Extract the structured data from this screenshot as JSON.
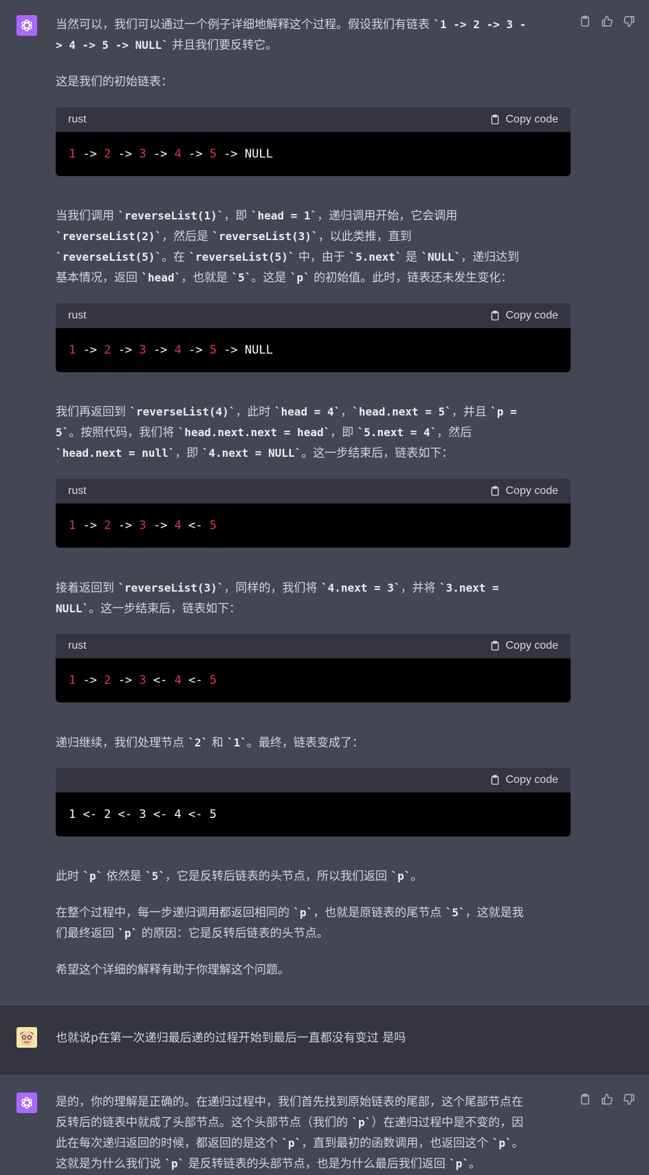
{
  "messages": [
    {
      "role": "assistant",
      "p1_a": "当然可以，我们可以通过一个例子详细地解释这个过程。假设我们有链表 ",
      "p1_code": "`1 -> 2 -> 3 -",
      "p1_code2": "> 4 -> 5 -> NULL`",
      "p1_b": " 并且我们要反转它。",
      "p2": "这是我们的初始链表：",
      "code1": {
        "lang": "rust",
        "copy_label": "Copy code",
        "tokens": [
          "1",
          " -> ",
          "2",
          " -> ",
          "3",
          " -> ",
          "4",
          " -> ",
          "5",
          " -> NULL"
        ]
      },
      "p3": {
        "l1_a": "当我们调用 ",
        "l1_c1": "`reverseList(1)`",
        "l1_b": "，即 ",
        "l1_c2": "`head = 1`",
        "l1_d": "，递归调用开始，它会调用",
        "l2_c1": "`reverseList(2)`",
        "l2_a": "，然后是 ",
        "l2_c2": "`reverseList(3)`",
        "l2_b": "，以此类推，直到",
        "l3_c1": "`reverseList(5)`",
        "l3_a": "。在 ",
        "l3_c2": "`reverseList(5)`",
        "l3_b": " 中，由于 ",
        "l3_c3": "`5.next`",
        "l3_d": " 是 ",
        "l3_c4": "`NULL`",
        "l3_e": "，递归达到",
        "l4_a": "基本情况，返回 ",
        "l4_c1": "`head`",
        "l4_b": "，也就是 ",
        "l4_c2": "`5`",
        "l4_d": "。这是 ",
        "l4_c3": "`p`",
        "l4_e": " 的初始值。此时，链表还未发生变化："
      },
      "code2": {
        "lang": "rust",
        "copy_label": "Copy code",
        "tokens": [
          "1",
          " -> ",
          "2",
          " -> ",
          "3",
          " -> ",
          "4",
          " -> ",
          "5",
          " -> NULL"
        ]
      },
      "p4": {
        "l1_a": "我们再返回到 ",
        "l1_c1": "`reverseList(4)`",
        "l1_b": "，此时 ",
        "l1_c2": "`head = 4`",
        "l1_d": "，",
        "l1_c3": "`head.next = 5`",
        "l1_e": "，并且 ",
        "l1_c4": "`p =",
        "l2_c1": "5`",
        "l2_a": "。按照代码，我们将 ",
        "l2_c2": "`head.next.next = head`",
        "l2_b": "，即 ",
        "l2_c3": "`5.next = 4`",
        "l2_d": "，然后",
        "l3_c1": "`head.next = null`",
        "l3_a": "，即 ",
        "l3_c2": "`4.next = NULL`",
        "l3_b": "。这一步结束后，链表如下："
      },
      "code3": {
        "lang": "rust",
        "copy_label": "Copy code",
        "tokens": [
          "1",
          " -> ",
          "2",
          " -> ",
          "3",
          " -> ",
          "4",
          " <- ",
          "5"
        ]
      },
      "p5": {
        "l1_a": "接着返回到 ",
        "l1_c1": "`reverseList(3)`",
        "l1_b": "，同样的，我们将 ",
        "l1_c2": "`4.next = 3`",
        "l1_d": "，并将 ",
        "l1_c3": "`3.next =",
        "l2_c1": "NULL`",
        "l2_a": "。这一步结束后，链表如下："
      },
      "code4": {
        "lang": "rust",
        "copy_label": "Copy code",
        "tokens": [
          "1",
          " -> ",
          "2",
          " -> ",
          "3",
          " <- ",
          "4",
          " <- ",
          "5"
        ]
      },
      "p6": {
        "a": "递归继续，我们处理节点 ",
        "c1": "`2`",
        "b": " 和 ",
        "c2": "`1`",
        "d": "。最终，链表变成了："
      },
      "code5": {
        "copy_label": "Copy code",
        "text": "1 <- 2 <- 3 <- 4 <- 5"
      },
      "p7": {
        "a": "此时 ",
        "c1": "`p`",
        "b": " 依然是 ",
        "c2": "`5`",
        "d": "，它是反转后链表的头节点，所以我们返回 ",
        "c3": "`p`",
        "e": "。"
      },
      "p8": {
        "l1_a": "在整个过程中，每一步递归调用都返回相同的 ",
        "l1_c1": "`p`",
        "l1_b": "，也就是原链表的尾节点 ",
        "l1_c2": "`5`",
        "l1_d": "，这就是我",
        "l2_a": "们最终返回 ",
        "l2_c1": "`p`",
        "l2_b": " 的原因：它是反转后链表的头节点。"
      },
      "p9": "希望这个详细的解释有助于你理解这个问题。"
    },
    {
      "role": "user",
      "text": "也就说p在第一次递归最后递的过程开始到最后一直都没有变过 是吗"
    },
    {
      "role": "assistant",
      "l1": "是的，你的理解是正确的。在递归过程中，我们首先找到原始链表的尾部，这个尾部节点在",
      "l2_a": "反转后的链表中就成了头部节点。这个头部节点（我们的 ",
      "l2_c1": "`p`",
      "l2_b": "）在递归过程中是不变的，因",
      "l3_a": "此在每次递归返回的时候，都返回的是这个 ",
      "l3_c1": "`p`",
      "l3_b": "，直到最初的函数调用，也返回这个 ",
      "l3_c2": "`p`",
      "l3_d": "。",
      "l4_a": "这就是为什么我们说 ",
      "l4_c1": "`p`",
      "l4_b": " 是反转链表的头部节点，也是为什么最后我们返回 ",
      "l4_c2": "`p`",
      "l4_d": "。"
    }
  ],
  "colors": {
    "assistant_bg": "#444654",
    "user_bg": "#343541",
    "gpt_avatar": "#ab68ff",
    "number_token": "#df3079"
  }
}
